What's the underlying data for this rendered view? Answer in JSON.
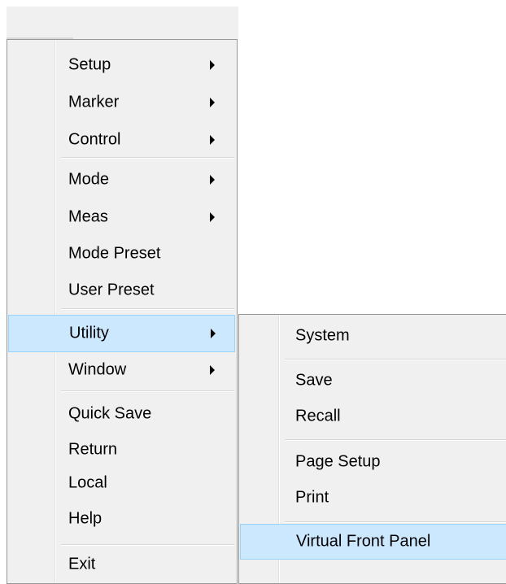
{
  "menu": {
    "items": [
      {
        "label": "Setup",
        "submenu": true
      },
      {
        "label": "Marker",
        "submenu": true
      },
      {
        "label": "Control",
        "submenu": true
      },
      {
        "label": "Mode",
        "submenu": true
      },
      {
        "label": "Meas",
        "submenu": true
      },
      {
        "label": "Mode Preset",
        "submenu": false
      },
      {
        "label": "User Preset",
        "submenu": false
      },
      {
        "label": "Utility",
        "submenu": true,
        "highlighted": true
      },
      {
        "label": "Window",
        "submenu": true
      },
      {
        "label": "Quick Save",
        "submenu": false
      },
      {
        "label": "Return",
        "submenu": false
      },
      {
        "label": "Local",
        "submenu": false
      },
      {
        "label": "Help",
        "submenu": false
      },
      {
        "label": "Exit",
        "submenu": false
      }
    ]
  },
  "submenu": {
    "items": [
      {
        "label": "System"
      },
      {
        "label": "Save"
      },
      {
        "label": "Recall"
      },
      {
        "label": "Page Setup"
      },
      {
        "label": "Print"
      },
      {
        "label": "Virtual Front Panel",
        "highlighted": true
      }
    ]
  },
  "colors": {
    "menu_bg": "#f0f0f0",
    "highlight_bg": "#cce8ff",
    "highlight_border": "#99d1ff",
    "border": "#979797"
  }
}
